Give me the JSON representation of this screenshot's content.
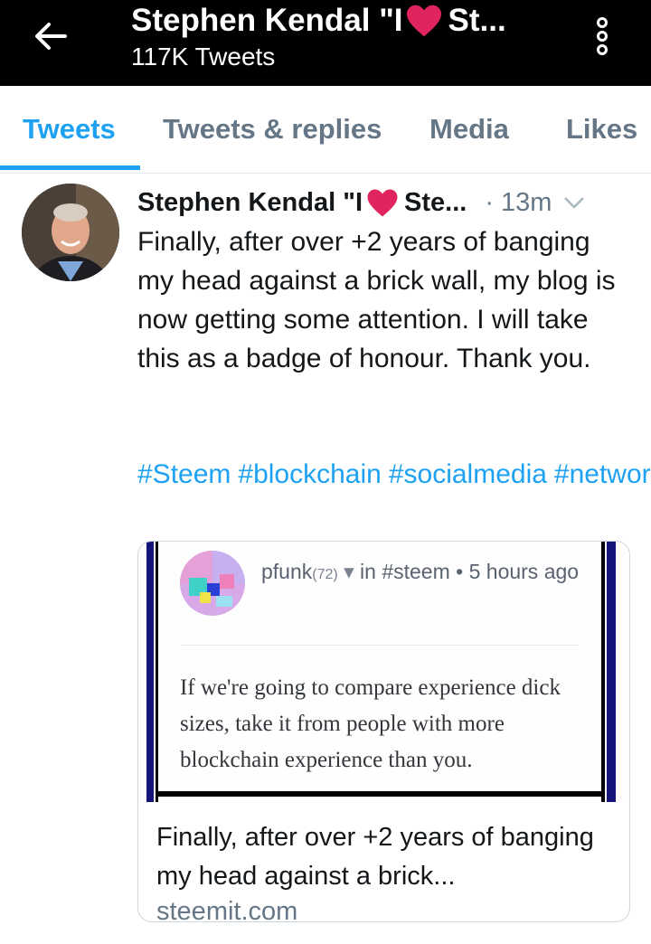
{
  "header": {
    "title_prefix": "Stephen Kendal \"I",
    "title_suffix": "St...",
    "subtitle": "117K Tweets",
    "back_icon": "arrow-left-icon",
    "overflow_icon": "overflow-menu-icon"
  },
  "tabs": [
    {
      "label": "Tweets",
      "active": true
    },
    {
      "label": "Tweets & replies",
      "active": false
    },
    {
      "label": "Media",
      "active": false
    },
    {
      "label": "Likes",
      "active": false
    }
  ],
  "tweet": {
    "author_prefix": "Stephen Kendal \"I",
    "author_suffix": "Ste...",
    "time": "· 13m",
    "text": "Finally, after over +2 years of banging my head against a brick wall, my blog is now getting some attention. I will take this as a badge of honour. Thank you.",
    "hashtags": [
      "#Steem",
      "#blockchain",
      "#socialmedia",
      "#network"
    ],
    "card": {
      "image": {
        "user": "pfunk",
        "reputation": "(72)",
        "meta": "in #steem • 5 hours ago",
        "quote": "If we're going to compare experience dick sizes, take it from people with more blockchain experience than you."
      },
      "title": "Finally, after over +2 years of banging my head against a brick...",
      "domain": "steemit.com"
    }
  },
  "colors": {
    "accent": "#1da1f2",
    "heart": "#e0245e",
    "header_bg": "#000000",
    "muted": "#657786"
  }
}
